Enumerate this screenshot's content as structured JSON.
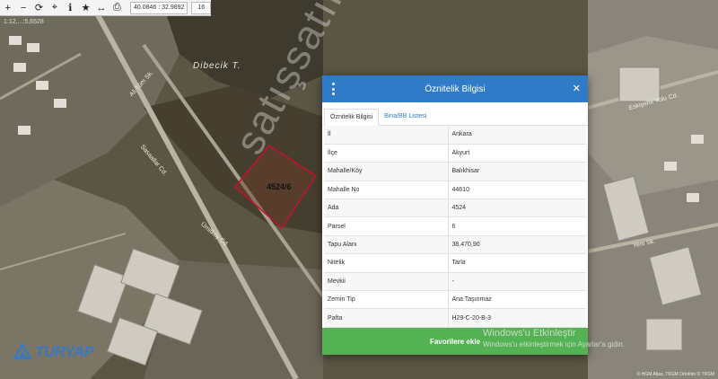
{
  "toolbar": {
    "coordinates": "40.0846 : 32.9892",
    "zoom": "16"
  },
  "map": {
    "scale_text": "1:12,...:5,6528",
    "place_label": "Dibecik T.",
    "parcel_label": "4524/6",
    "road_labels": [
      "Ali Tüm Sk.",
      "Sasaallar Cd.",
      "Ümitköy Cd.",
      "Eskişehir Yolu Cd.",
      "Yeni Sk."
    ],
    "colors": {
      "parcel_stroke": "#c8102e",
      "accent": "#2f7bc8"
    }
  },
  "brand": {
    "name": "TURYAP"
  },
  "attribution": "© HGM Atlas, TKGM Ortofoto © TKGM",
  "modal": {
    "title": "Öznitelik Bilgisi",
    "tabs": [
      {
        "label": "Öznitelik Bilgisi",
        "active": true
      },
      {
        "label": "Bina/BB Listesi",
        "active": false
      }
    ],
    "rows": [
      {
        "key": "İl",
        "value": "Ankara"
      },
      {
        "key": "İlçe",
        "value": "Akyurt"
      },
      {
        "key": "Mahalle/Köy",
        "value": "Balıkhisar"
      },
      {
        "key": "Mahalle No",
        "value": "44610"
      },
      {
        "key": "Ada",
        "value": "4524"
      },
      {
        "key": "Parsel",
        "value": "6"
      },
      {
        "key": "Tapu Alanı",
        "value": "38.470,90"
      },
      {
        "key": "Nitelik",
        "value": "Tarla"
      },
      {
        "key": "Mevkii",
        "value": "-"
      },
      {
        "key": "Zemin Tip",
        "value": "Ana Taşınmaz"
      },
      {
        "key": "Pafta",
        "value": "H29-C-20-B-3"
      }
    ],
    "favorite_button": "Favorilere ekle"
  },
  "watermark": "satışsatılık",
  "windows_activation": {
    "title": "Windows'u Etkinleştir",
    "subtitle": "Windows'u etkinleştirmek için Ayarlar'a gidin."
  }
}
